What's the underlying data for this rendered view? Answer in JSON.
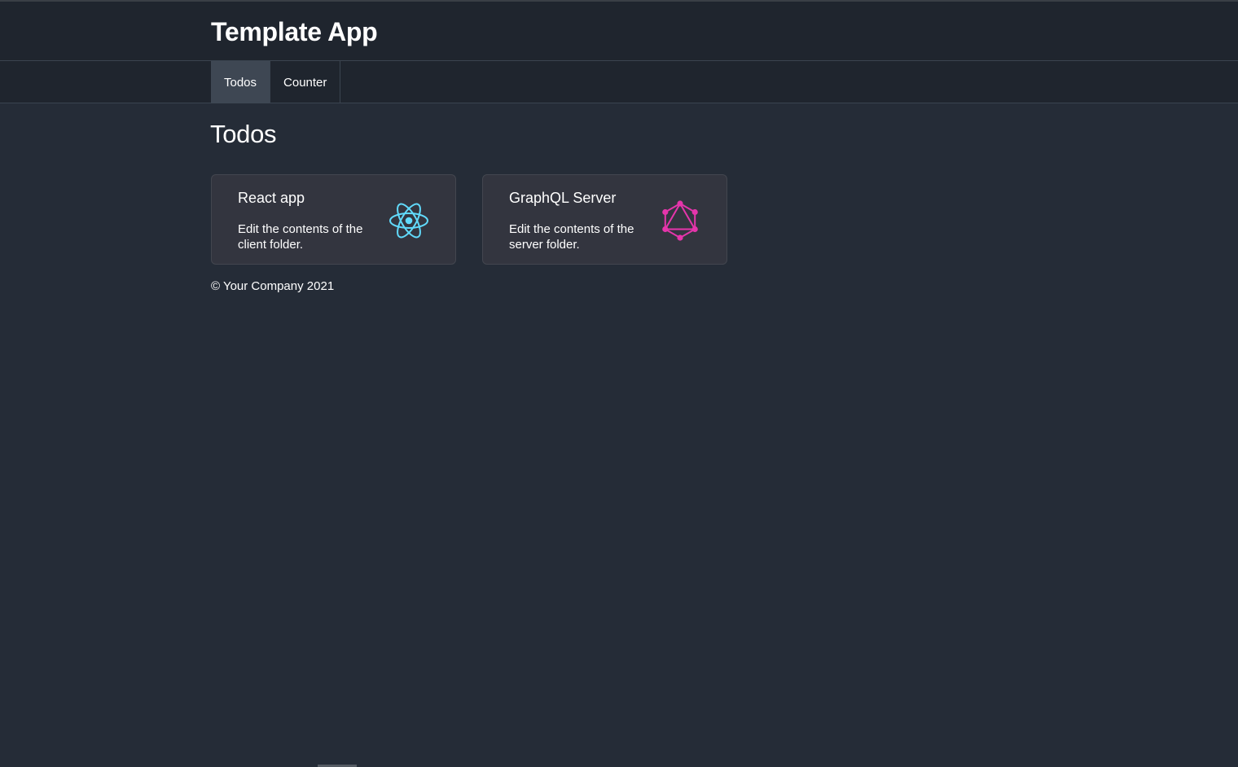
{
  "app": {
    "title": "Template App"
  },
  "nav": {
    "tabs": [
      {
        "label": "Todos",
        "active": true
      },
      {
        "label": "Counter",
        "active": false
      }
    ]
  },
  "main": {
    "page_title": "Todos",
    "cards": [
      {
        "title": "React app",
        "text": "Edit the contents of the client folder.",
        "icon": "react-icon",
        "icon_color": "#61dafb"
      },
      {
        "title": "GraphQL Server",
        "text": "Edit the contents of the server folder.",
        "icon": "graphql-icon",
        "icon_color": "#e535ab"
      }
    ]
  },
  "footer": {
    "copyright": "© Your Company 2021"
  },
  "colors": {
    "background": "#252c37",
    "header_bg": "#1f252e",
    "active_tab_bg": "#3e4753",
    "card_bg": "#33353f"
  }
}
